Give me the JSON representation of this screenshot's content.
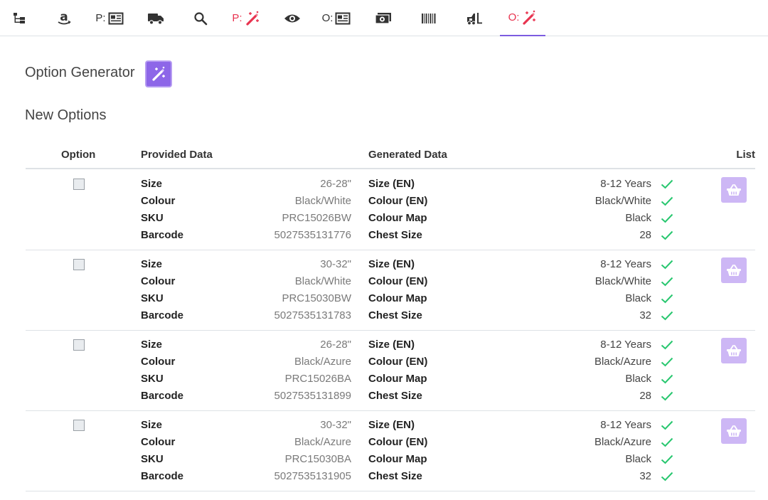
{
  "tabs": [
    {
      "prefix": "",
      "icon": "sitemap-icon"
    },
    {
      "prefix": "",
      "icon": "amazon-icon"
    },
    {
      "prefix": "P:",
      "icon": "newspaper-icon"
    },
    {
      "prefix": "",
      "icon": "truck-icon"
    },
    {
      "prefix": "",
      "icon": "search-icon"
    },
    {
      "prefix": "P:",
      "icon": "magic-wand-icon"
    },
    {
      "prefix": "",
      "icon": "eye-icon"
    },
    {
      "prefix": "O:",
      "icon": "newspaper-icon"
    },
    {
      "prefix": "",
      "icon": "money-icon"
    },
    {
      "prefix": "",
      "icon": "barcode-icon"
    },
    {
      "prefix": "",
      "icon": "forklift-icon"
    },
    {
      "prefix": "O:",
      "icon": "magic-wand-icon"
    }
  ],
  "colors": {
    "accent": "#8d66e8",
    "accent_light": "#cdb7f5",
    "danger": "#e8334f",
    "success": "#28c76f"
  },
  "header": {
    "title": "Option Generator",
    "section_title": "New Options"
  },
  "table": {
    "columns": {
      "option": "Option",
      "provided": "Provided Data",
      "generated": "Generated Data",
      "list": "List"
    },
    "rows": [
      {
        "provided": [
          {
            "label": "Size",
            "value": "26-28\""
          },
          {
            "label": "Colour",
            "value": "Black/White"
          },
          {
            "label": "SKU",
            "value": "PRC15026BW"
          },
          {
            "label": "Barcode",
            "value": "5027535131776"
          }
        ],
        "generated": [
          {
            "label": "Size (EN)",
            "value": "8-12 Years"
          },
          {
            "label": "Colour (EN)",
            "value": "Black/White"
          },
          {
            "label": "Colour Map",
            "value": "Black"
          },
          {
            "label": "Chest Size",
            "value": "28"
          }
        ]
      },
      {
        "provided": [
          {
            "label": "Size",
            "value": "30-32\""
          },
          {
            "label": "Colour",
            "value": "Black/White"
          },
          {
            "label": "SKU",
            "value": "PRC15030BW"
          },
          {
            "label": "Barcode",
            "value": "5027535131783"
          }
        ],
        "generated": [
          {
            "label": "Size (EN)",
            "value": "8-12 Years"
          },
          {
            "label": "Colour (EN)",
            "value": "Black/White"
          },
          {
            "label": "Colour Map",
            "value": "Black"
          },
          {
            "label": "Chest Size",
            "value": "32"
          }
        ]
      },
      {
        "provided": [
          {
            "label": "Size",
            "value": "26-28\""
          },
          {
            "label": "Colour",
            "value": "Black/Azure"
          },
          {
            "label": "SKU",
            "value": "PRC15026BA"
          },
          {
            "label": "Barcode",
            "value": "5027535131899"
          }
        ],
        "generated": [
          {
            "label": "Size (EN)",
            "value": "8-12 Years"
          },
          {
            "label": "Colour (EN)",
            "value": "Black/Azure"
          },
          {
            "label": "Colour Map",
            "value": "Black"
          },
          {
            "label": "Chest Size",
            "value": "28"
          }
        ]
      },
      {
        "provided": [
          {
            "label": "Size",
            "value": "30-32\""
          },
          {
            "label": "Colour",
            "value": "Black/Azure"
          },
          {
            "label": "SKU",
            "value": "PRC15030BA"
          },
          {
            "label": "Barcode",
            "value": "5027535131905"
          }
        ],
        "generated": [
          {
            "label": "Size (EN)",
            "value": "8-12 Years"
          },
          {
            "label": "Colour (EN)",
            "value": "Black/Azure"
          },
          {
            "label": "Colour Map",
            "value": "Black"
          },
          {
            "label": "Chest Size",
            "value": "32"
          }
        ]
      }
    ]
  }
}
